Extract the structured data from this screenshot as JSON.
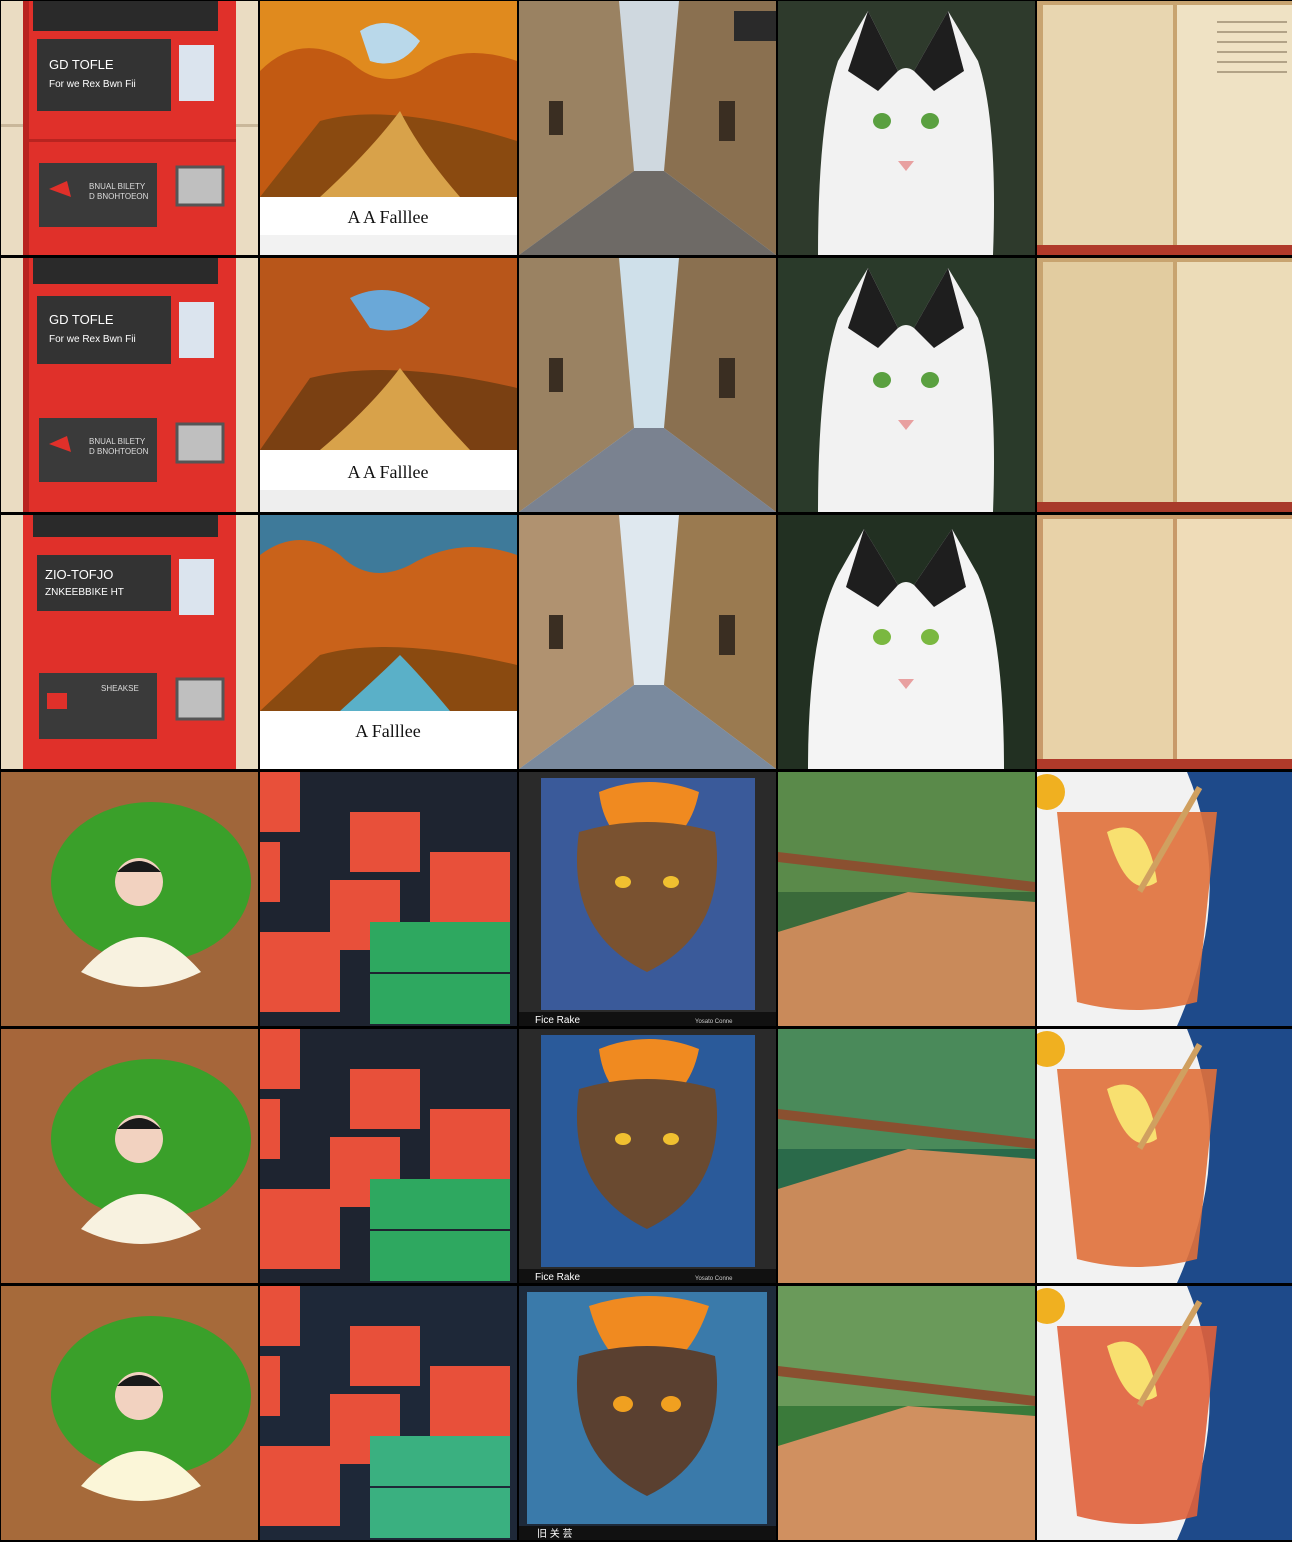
{
  "grid": {
    "columns": 5,
    "rows": 6
  },
  "colors": {
    "kiosk_red": "#e0302a",
    "forest_orange": "#d9781e",
    "street_stone": "#8a7a62",
    "cat_white": "#f2f2f2",
    "book_paper": "#e8d6b0",
    "wood_floor": "#a0663a",
    "block_red": "#e8503a",
    "block_green": "#2ea860",
    "deck_wood": "#c98a5a",
    "tea_amber": "#e0703a",
    "napkin_blue": "#1e4a8a"
  },
  "cells": {
    "r1": {
      "kiosk": {
        "panel_line1": "GD TOFLE",
        "panel_line2": "For we Rex Bwn Fii",
        "lower_line1": "BNUAL BILETY",
        "lower_line2": "D BNOHTOEON"
      },
      "painting": {
        "caption": "A A Falllee"
      }
    },
    "r2": {
      "kiosk": {
        "panel_line1": "GD TOFLE",
        "panel_line2": "For we Rex Bwn Fii",
        "lower_line1": "BNUAL BILETY",
        "lower_line2": "D BNOHTOEON"
      },
      "painting": {
        "caption": "A A Falllee"
      }
    },
    "r3": {
      "kiosk": {
        "panel_line1": "ZIO-TOFJO",
        "panel_line2": "ZNKEEBBIKE HT",
        "lower_line1": "SHEAKSE"
      },
      "painting": {
        "caption": "A   Falllee"
      }
    },
    "r4": {
      "poster": {
        "title": "Fice Rake",
        "signature": "Yosato Conne"
      }
    },
    "r5": {
      "poster": {
        "title": "Fice Rake",
        "signature": "Yosato Conne"
      }
    },
    "r6": {
      "poster": {
        "title": "旧 关 芸"
      }
    }
  }
}
